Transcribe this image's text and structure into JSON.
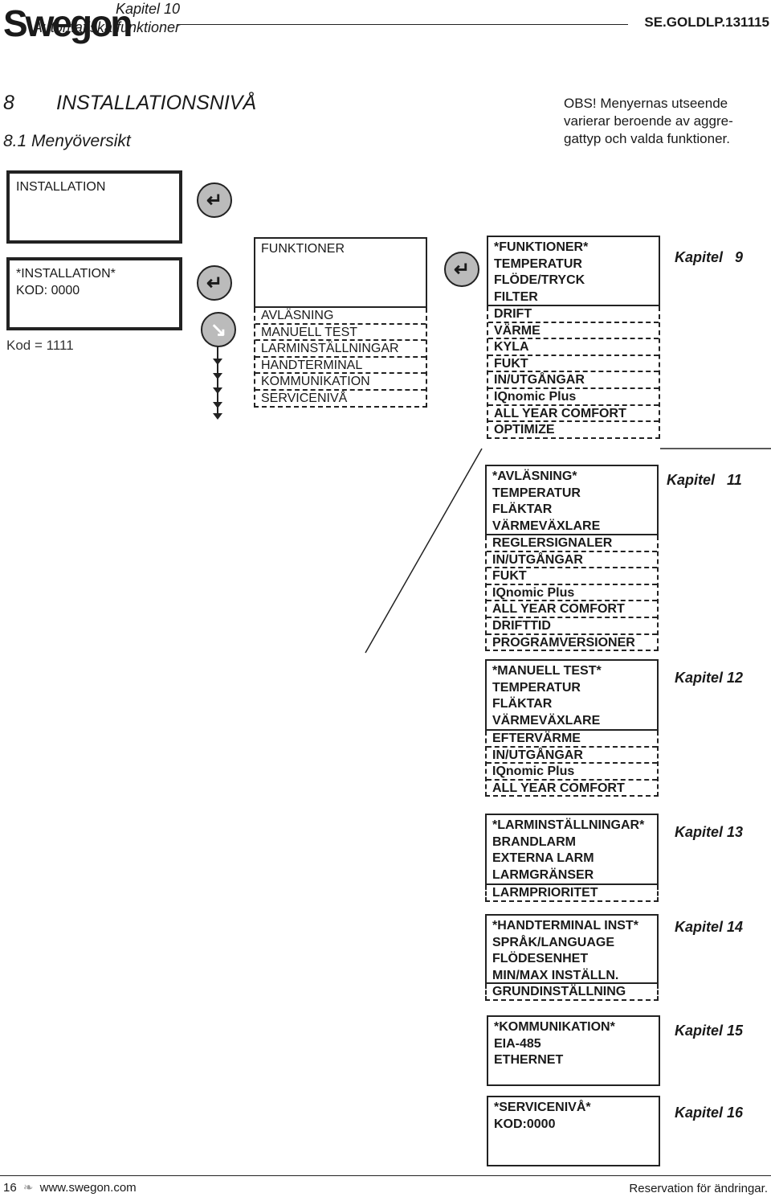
{
  "header": {
    "logo": "Swegon",
    "doc_id": "SE.GOLDLP.131115"
  },
  "title": {
    "number": "8",
    "text": "INSTALLATIONSNIVÅ",
    "subtitle": "8.1 Menyöversikt"
  },
  "note": [
    "OBS! Menyernas utseende",
    "varierar beroende av aggre-",
    "gattyp och valda funktioner."
  ],
  "screens": {
    "installation": "INSTALLATION",
    "login": [
      "*INSTALLATION*",
      "KOD: 0000"
    ],
    "code_hint": "Kod = 1111"
  },
  "icons": {
    "enter": "enter-key-icon",
    "down": "arrow-down-right-icon",
    "chain": "down-arrow-chain-icon"
  },
  "menus": [
    {
      "head": [
        "FUNKTIONER"
      ],
      "items": [
        "AVLÄSNING",
        "MANUELL TEST",
        "LARMINSTÄLLNINGAR",
        "HANDTERMINAL",
        "KOMMUNIKATION",
        "SERVICENIVÅ"
      ],
      "light": true
    },
    {
      "head": [
        "*FUNKTIONER*",
        "TEMPERATUR",
        "FLÖDE/TRYCK",
        "FILTER"
      ],
      "items": [
        "DRIFT",
        "VÄRME",
        "KYLA",
        "FUKT",
        "IN/UTGÅNGAR",
        "IQnomic Plus",
        "ALL YEAR COMFORT",
        "OPTIMIZE"
      ],
      "chapter": "Kapitel   9"
    },
    {
      "head": [
        "*AVLÄSNING*",
        "TEMPERATUR",
        "FLÄKTAR",
        "VÄRMEVÄXLARE"
      ],
      "items": [
        "REGLERSIGNALER",
        "IN/UTGÅNGAR",
        "FUKT",
        "IQnomic Plus",
        "ALL YEAR COMFORT",
        "DRIFTTID",
        "PROGRAMVERSIONER"
      ],
      "chapter": "Kapitel   11"
    },
    {
      "head": [
        "*MANUELL TEST*",
        "TEMPERATUR",
        "FLÄKTAR",
        "VÄRMEVÄXLARE"
      ],
      "items": [
        "EFTERVÄRME",
        "IN/UTGÅNGAR",
        "IQnomic Plus",
        "ALL YEAR COMFORT"
      ],
      "chapter": "Kapitel 12"
    },
    {
      "head": [
        "*LARMINSTÄLLNINGAR*",
        "BRANDLARM",
        "EXTERNA LARM",
        "LARMGRÄNSER"
      ],
      "items": [
        "LARMPRIORITET"
      ],
      "chapter": "Kapitel 13"
    },
    {
      "head": [
        "*HANDTERMINAL INST*",
        "SPRÅK/LANGUAGE",
        "FLÖDESENHET",
        "MIN/MAX INSTÄLLN."
      ],
      "items": [
        "GRUNDINSTÄLLNING"
      ],
      "chapter": "Kapitel 14"
    },
    {
      "head": [
        "*KOMMUNIKATION*",
        "EIA-485",
        "ETHERNET"
      ],
      "items": [],
      "chapter": "Kapitel 15"
    },
    {
      "head": [
        "*SERVICENIVÅ*",
        "KOD:0000"
      ],
      "items": [],
      "chapter": "Kapitel 16"
    }
  ],
  "chapter10": {
    "label": "Kapitel   10",
    "text": "Automatiska funktioner"
  },
  "footer": {
    "page": "16",
    "url": "www.swegon.com",
    "disclaimer": "Reservation för ändringar."
  }
}
